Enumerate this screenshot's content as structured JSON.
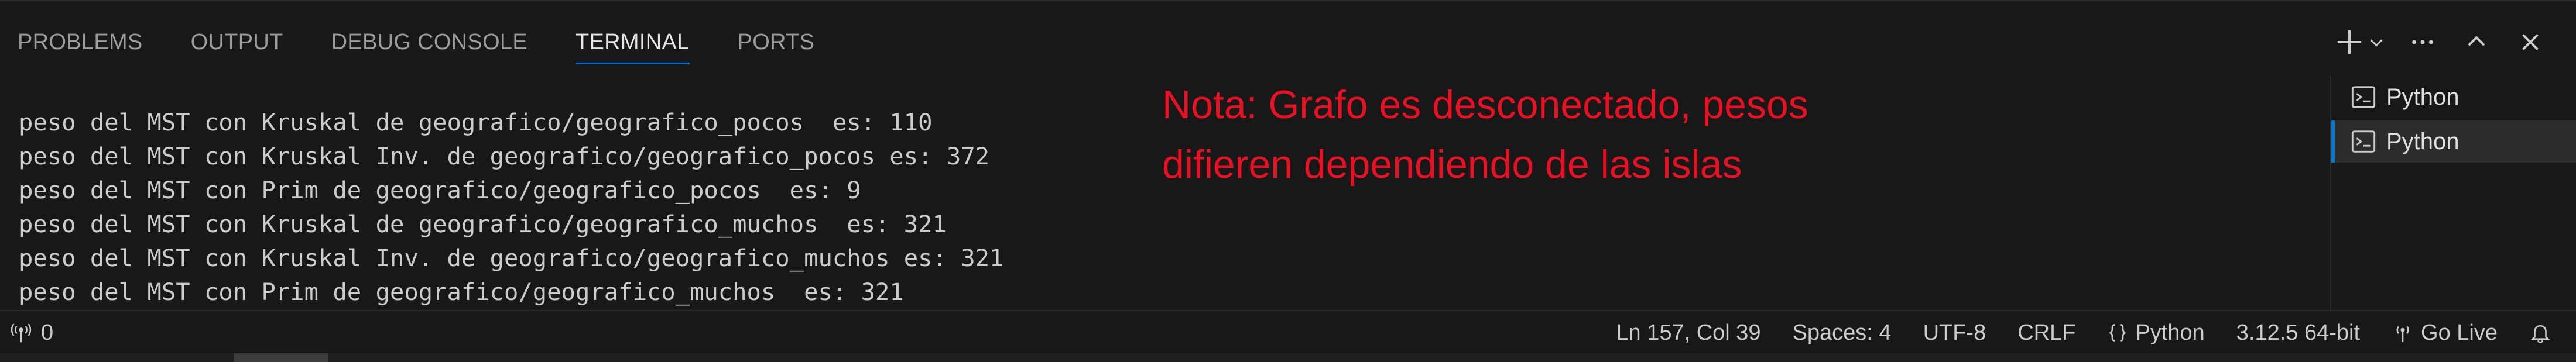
{
  "panel": {
    "tabs": [
      {
        "label": "PROBLEMS",
        "active": false
      },
      {
        "label": "OUTPUT",
        "active": false
      },
      {
        "label": "DEBUG CONSOLE",
        "active": false
      },
      {
        "label": "TERMINAL",
        "active": true
      },
      {
        "label": "PORTS",
        "active": false
      }
    ],
    "actions": [
      "plus-icon",
      "chevron-down-icon",
      "ellipsis-icon",
      "chevron-up-icon",
      "close-icon"
    ],
    "accent": "#0078d4"
  },
  "terminal": {
    "lines": [
      "peso del MST con Kruskal de geografico/geografico_pocos  es: 110",
      "peso del MST con Kruskal Inv. de geografico/geografico_pocos es: 372",
      "peso del MST con Prim de geografico/geografico_pocos  es: 9",
      "peso del MST con Kruskal de geografico/geografico_muchos  es: 321",
      "peso del MST con Kruskal Inv. de geografico/geografico_muchos es: 321",
      "peso del MST con Prim de geografico/geografico_muchos  es: 321"
    ]
  },
  "annotation": {
    "lines": [
      "Nota: Grafo es desconectado, pesos",
      "difieren dependiendo de las islas"
    ],
    "color": "#e81123"
  },
  "terminal_list": [
    {
      "label": "Python",
      "icon": "terminal-icon",
      "selected": false
    },
    {
      "label": "Python",
      "icon": "terminal-icon",
      "selected": true
    }
  ],
  "statusbar": {
    "ports": "0",
    "cursor": "Ln 157, Col 39",
    "spaces": "Spaces: 4",
    "encoding": "UTF-8",
    "eol": "CRLF",
    "language": "Python",
    "interpreter": "3.12.5 64-bit",
    "golive": "Go Live"
  }
}
